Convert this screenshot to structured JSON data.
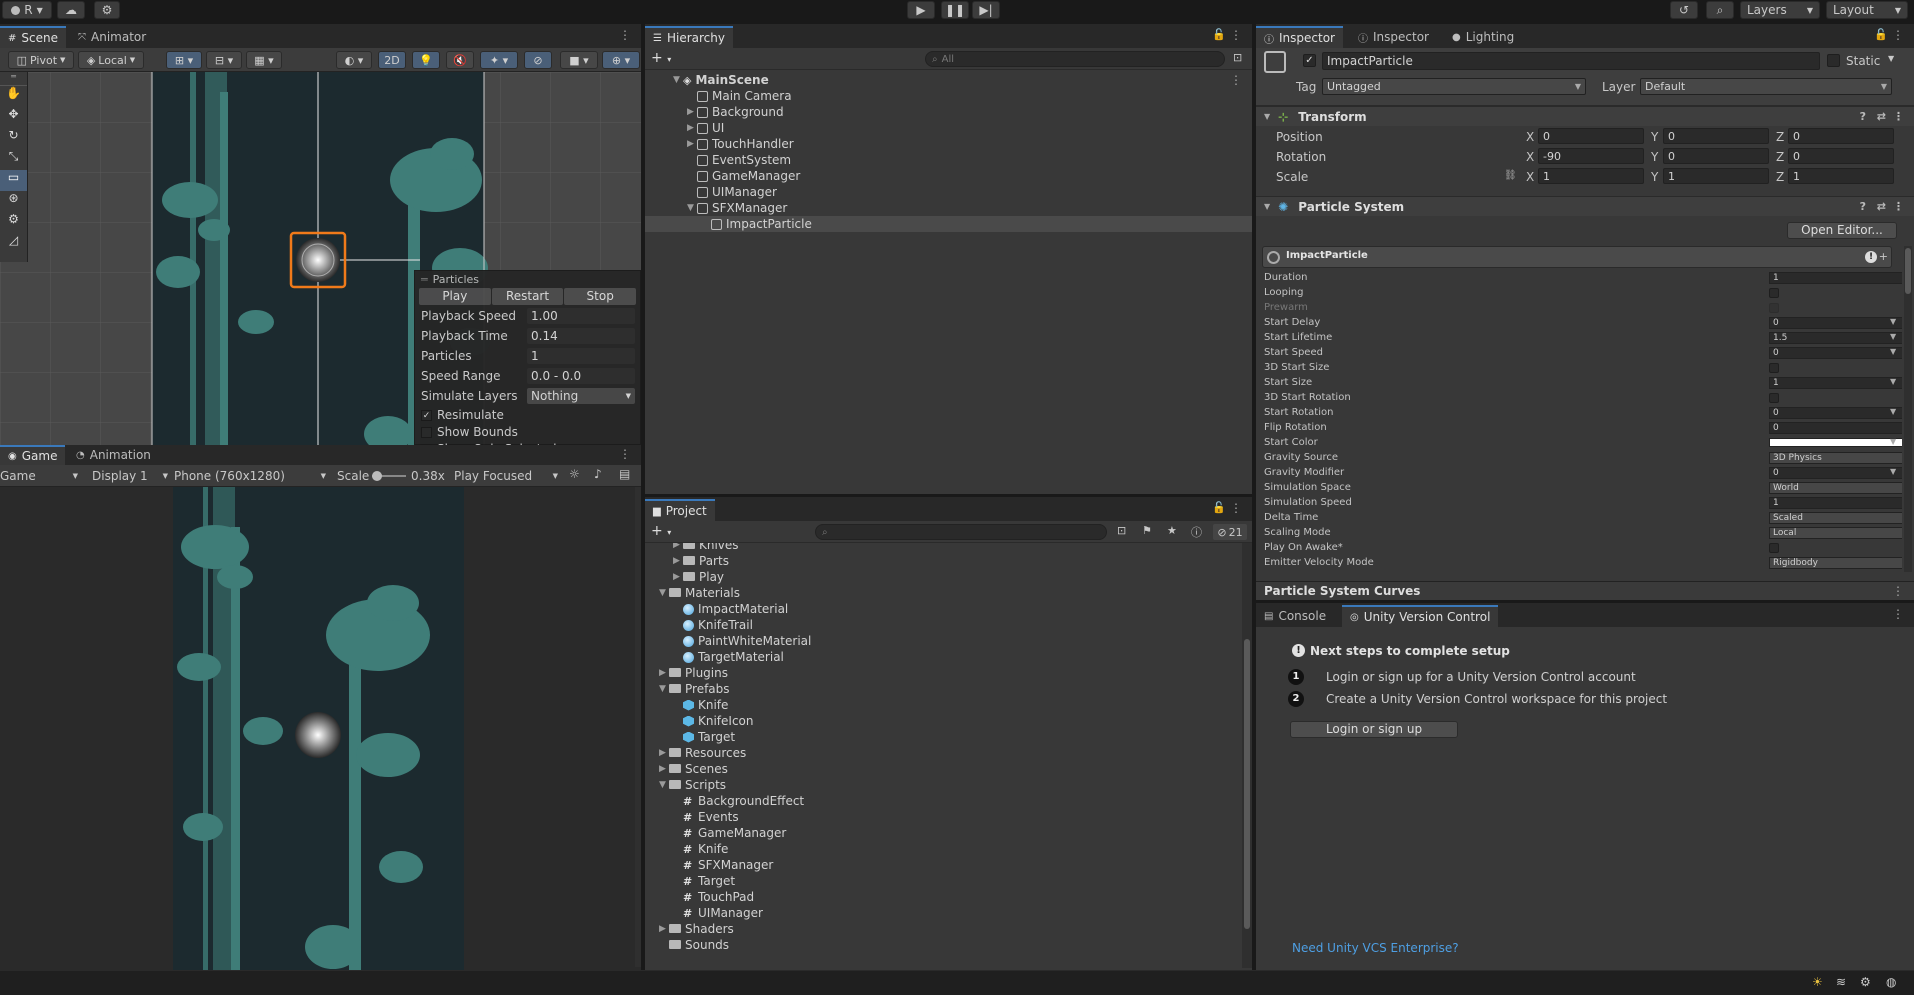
{
  "toolbar": {
    "account": "R",
    "layers": "Layers",
    "layout": "Layout"
  },
  "scene": {
    "tabs": [
      "Scene",
      "Animator"
    ],
    "pivot": "Pivot",
    "local": "Local",
    "mode_2d": "2D"
  },
  "particles_overlay": {
    "title": "Particles",
    "play": "Play",
    "restart": "Restart",
    "stop": "Stop",
    "rows": [
      {
        "label": "Playback Speed",
        "value": "1.00"
      },
      {
        "label": "Playback Time",
        "value": "0.14"
      },
      {
        "label": "Particles",
        "value": "1"
      },
      {
        "label": "Speed Range",
        "value": "0.0 - 0.0"
      },
      {
        "label": "Simulate Layers",
        "value": "Nothing"
      }
    ],
    "checks": [
      {
        "label": "Resimulate",
        "checked": true
      },
      {
        "label": "Show Bounds",
        "checked": false
      },
      {
        "label": "Show Only Selected",
        "checked": false
      }
    ]
  },
  "game": {
    "tabs": [
      "Game",
      "Animation"
    ],
    "mode": "Game",
    "display": "Display 1",
    "resolution": "Phone (760x1280)",
    "scale_label": "Scale",
    "scale_value": "0.38x",
    "play_focused": "Play Focused"
  },
  "hierarchy": {
    "tab": "Hierarchy",
    "search_placeholder": "All",
    "items": [
      {
        "label": "MainScene",
        "depth": 0,
        "arrow": "down",
        "bold": true
      },
      {
        "label": "Main Camera",
        "depth": 1,
        "arrow": ""
      },
      {
        "label": "Background",
        "depth": 1,
        "arrow": "right"
      },
      {
        "label": "UI",
        "depth": 1,
        "arrow": "right"
      },
      {
        "label": "TouchHandler",
        "depth": 1,
        "arrow": "right"
      },
      {
        "label": "EventSystem",
        "depth": 1,
        "arrow": ""
      },
      {
        "label": "GameManager",
        "depth": 1,
        "arrow": ""
      },
      {
        "label": "UIManager",
        "depth": 1,
        "arrow": ""
      },
      {
        "label": "SFXManager",
        "depth": 1,
        "arrow": "down"
      },
      {
        "label": "ImpactParticle",
        "depth": 2,
        "arrow": "",
        "selected": true
      }
    ]
  },
  "project": {
    "tab": "Project",
    "hidden_count": "21",
    "items": [
      {
        "label": "Knives",
        "depth": 1,
        "type": "folder",
        "arrow": "right"
      },
      {
        "label": "Parts",
        "depth": 1,
        "type": "folder",
        "arrow": "right"
      },
      {
        "label": "Play",
        "depth": 1,
        "type": "folder",
        "arrow": "right"
      },
      {
        "label": "Materials",
        "depth": 0,
        "type": "folder",
        "arrow": "down"
      },
      {
        "label": "ImpactMaterial",
        "depth": 1,
        "type": "material",
        "arrow": ""
      },
      {
        "label": "KnifeTrail",
        "depth": 1,
        "type": "material",
        "arrow": ""
      },
      {
        "label": "PaintWhiteMaterial",
        "depth": 1,
        "type": "material",
        "arrow": ""
      },
      {
        "label": "TargetMaterial",
        "depth": 1,
        "type": "material",
        "arrow": ""
      },
      {
        "label": "Plugins",
        "depth": 0,
        "type": "folder",
        "arrow": "right"
      },
      {
        "label": "Prefabs",
        "depth": 0,
        "type": "folder",
        "arrow": "down"
      },
      {
        "label": "Knife",
        "depth": 1,
        "type": "prefab",
        "arrow": ""
      },
      {
        "label": "KnifeIcon",
        "depth": 1,
        "type": "prefab",
        "arrow": ""
      },
      {
        "label": "Target",
        "depth": 1,
        "type": "prefab",
        "arrow": ""
      },
      {
        "label": "Resources",
        "depth": 0,
        "type": "folder",
        "arrow": "right"
      },
      {
        "label": "Scenes",
        "depth": 0,
        "type": "folder",
        "arrow": "right"
      },
      {
        "label": "Scripts",
        "depth": 0,
        "type": "folder",
        "arrow": "down"
      },
      {
        "label": "BackgroundEffect",
        "depth": 1,
        "type": "script",
        "arrow": ""
      },
      {
        "label": "Events",
        "depth": 1,
        "type": "script",
        "arrow": ""
      },
      {
        "label": "GameManager",
        "depth": 1,
        "type": "script",
        "arrow": ""
      },
      {
        "label": "Knife",
        "depth": 1,
        "type": "script",
        "arrow": ""
      },
      {
        "label": "SFXManager",
        "depth": 1,
        "type": "script",
        "arrow": ""
      },
      {
        "label": "Target",
        "depth": 1,
        "type": "script",
        "arrow": ""
      },
      {
        "label": "TouchPad",
        "depth": 1,
        "type": "script",
        "arrow": ""
      },
      {
        "label": "UIManager",
        "depth": 1,
        "type": "script",
        "arrow": ""
      },
      {
        "label": "Shaders",
        "depth": 0,
        "type": "folder",
        "arrow": "right"
      },
      {
        "label": "Sounds",
        "depth": 0,
        "type": "folder",
        "arrow": ""
      }
    ]
  },
  "inspector": {
    "tabs": [
      "Inspector",
      "Inspector",
      "Lighting"
    ],
    "object_name": "ImpactParticle",
    "static_label": "Static",
    "tag_label": "Tag",
    "tag_value": "Untagged",
    "layer_label": "Layer",
    "layer_value": "Default",
    "transform": {
      "title": "Transform",
      "rows": [
        {
          "label": "Position",
          "x": "0",
          "y": "0",
          "z": "0"
        },
        {
          "label": "Rotation",
          "x": "-90",
          "y": "0",
          "z": "0"
        },
        {
          "label": "Scale",
          "x": "1",
          "y": "1",
          "z": "1"
        }
      ]
    },
    "particle_system": {
      "title": "Particle System",
      "open_editor": "Open Editor...",
      "module_title": "ImpactParticle",
      "rows": [
        {
          "label": "Duration",
          "value": "1",
          "kind": "field"
        },
        {
          "label": "Looping",
          "value": "",
          "kind": "check"
        },
        {
          "label": "Prewarm",
          "value": "",
          "kind": "check",
          "disabled": true
        },
        {
          "label": "Start Delay",
          "value": "0",
          "kind": "field-dd"
        },
        {
          "label": "Start Lifetime",
          "value": "1.5",
          "kind": "field-dd"
        },
        {
          "label": "Start Speed",
          "value": "0",
          "kind": "field-dd"
        },
        {
          "label": "3D Start Size",
          "value": "",
          "kind": "check"
        },
        {
          "label": "Start Size",
          "value": "1",
          "kind": "field-dd"
        },
        {
          "label": "3D Start Rotation",
          "value": "",
          "kind": "check"
        },
        {
          "label": "Start Rotation",
          "value": "0",
          "kind": "field-dd"
        },
        {
          "label": "Flip Rotation",
          "value": "0",
          "kind": "field"
        },
        {
          "label": "Start Color",
          "value": "",
          "kind": "color"
        },
        {
          "label": "Gravity Source",
          "value": "3D Physics",
          "kind": "dropdown"
        },
        {
          "label": "Gravity Modifier",
          "value": "0",
          "kind": "field-dd"
        },
        {
          "label": "Simulation Space",
          "value": "World",
          "kind": "dropdown"
        },
        {
          "label": "Simulation Speed",
          "value": "1",
          "kind": "field"
        },
        {
          "label": "Delta Time",
          "value": "Scaled",
          "kind": "dropdown"
        },
        {
          "label": "Scaling Mode",
          "value": "Local",
          "kind": "dropdown"
        },
        {
          "label": "Play On Awake*",
          "value": "",
          "kind": "check"
        },
        {
          "label": "Emitter Velocity Mode",
          "value": "Rigidbody",
          "kind": "dropdown"
        }
      ],
      "curves_title": "Particle System Curves"
    }
  },
  "console": {
    "tabs": [
      "Console",
      "Unity Version Control"
    ],
    "heading": "Next steps to complete setup",
    "steps": [
      {
        "num": "1",
        "text": "Login or sign up for a Unity Version Control account"
      },
      {
        "num": "2",
        "text": "Create a Unity Version Control workspace for this project"
      }
    ],
    "button": "Login or sign up",
    "link": "Need Unity VCS Enterprise?"
  },
  "colors": {
    "accent": "#3a79bb",
    "selection_outline": "#f07a1a",
    "scene_bg": "#1c2a2f",
    "teal": "#3f7d78"
  }
}
